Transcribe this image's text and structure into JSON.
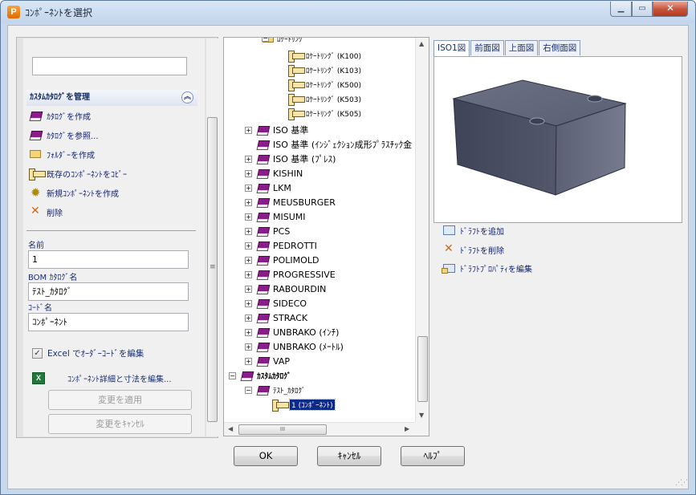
{
  "window": {
    "title": "ｺﾝﾎﾟｰﾈﾝﾄを選択",
    "app_icon_letter": "P"
  },
  "left_panel": {
    "search_value": "",
    "group_title": "ｶｽﾀﾑｶﾀﾛｸﾞを管理",
    "tasks": [
      {
        "label": "ｶﾀﾛｸﾞを作成",
        "icon": "book-create-icon"
      },
      {
        "label": "ｶﾀﾛｸﾞを参照...",
        "icon": "book-browse-icon"
      },
      {
        "label": "ﾌｫﾙﾀﾞｰを作成",
        "icon": "folder-icon"
      },
      {
        "label": "既存のｺﾝﾎﾟｰﾈﾝﾄをｺﾋﾟｰ",
        "icon": "component-copy-icon"
      },
      {
        "label": "新規ｺﾝﾎﾟｰﾈﾝﾄを作成",
        "icon": "gear-new-icon"
      },
      {
        "label": "削除",
        "icon": "delete-icon"
      }
    ],
    "fields": {
      "name_label": "名前",
      "name_value": "1",
      "bom_label": "BOM ｶﾀﾛｸﾞ名",
      "bom_value": "ﾃｽﾄ_ｶﾀﾛｸﾞ",
      "code_label": "ｺｰﾄﾞ名",
      "code_value": "ｺﾝﾎﾟｰﾈﾝﾄ"
    },
    "excel_checkbox_label": "Excel でｵｰﾀﾞｰｺｰﾄﾞを編集",
    "excel_checked": true,
    "edit_details_label": "ｺﾝﾎﾟｰﾈﾝﾄ詳細と寸法を編集...",
    "apply_button": "変更を適用",
    "cancel_changes_button": "変更をｷｬﾝｾﾙ"
  },
  "tree": {
    "partial_top_label": "ﾛｹｰﾄﾘﾝｸﾞ",
    "locate_rings": [
      "ﾛｹｰﾄﾘﾝｸﾞ (K100)",
      "ﾛｹｰﾄﾘﾝｸﾞ (K103)",
      "ﾛｹｰﾄﾘﾝｸﾞ (K500)",
      "ﾛｹｰﾄﾘﾝｸﾞ (K503)",
      "ﾛｹｰﾄﾘﾝｸﾞ (K505)"
    ],
    "catalogs": [
      {
        "label": "ISO 基準",
        "expandable": true
      },
      {
        "label": "ISO 基準 (ｲﾝｼﾞｪｸｼｮﾝ成形ﾌﾟﾗｽﾁｯｸ金",
        "expandable": false
      },
      {
        "label": "ISO 基準 (ﾌﾟﾚｽ)",
        "expandable": true
      },
      {
        "label": "KISHIN",
        "expandable": true
      },
      {
        "label": "LKM",
        "expandable": true
      },
      {
        "label": "MEUSBURGER",
        "expandable": true
      },
      {
        "label": "MISUMI",
        "expandable": true
      },
      {
        "label": "PCS",
        "expandable": true
      },
      {
        "label": "PEDROTTI",
        "expandable": true
      },
      {
        "label": "POLIMOLD",
        "expandable": true
      },
      {
        "label": "PROGRESSIVE",
        "expandable": true
      },
      {
        "label": "RABOURDIN",
        "expandable": true
      },
      {
        "label": "SIDECO",
        "expandable": true
      },
      {
        "label": "STRACK",
        "expandable": true
      },
      {
        "label": "UNBRAKO (ｲﾝﾁ)",
        "expandable": true
      },
      {
        "label": "UNBRAKO (ﾒｰﾄﾙ)",
        "expandable": true
      },
      {
        "label": "VAP",
        "expandable": true
      }
    ],
    "custom_root": "ｶｽﾀﾑｶﾀﾛｸﾞ",
    "custom_catalog": "ﾃｽﾄ_ｶﾀﾛｸﾞ",
    "selected_component": "1 (ｺﾝﾎﾟｰﾈﾝﾄ)",
    "scroll_grip": "III"
  },
  "preview": {
    "tabs": [
      "ISO1図",
      "前面図",
      "上面図",
      "右側面図"
    ],
    "active_tab": 0
  },
  "draft_tasks": [
    {
      "label": "ﾄﾞﾗﾌﾄを追加",
      "icon": "draft-add-icon"
    },
    {
      "label": "ﾄﾞﾗﾌﾄを削除",
      "icon": "delete-icon"
    },
    {
      "label": "ﾄﾞﾗﾌﾄﾌﾟﾛﾊﾟﾃｨを編集",
      "icon": "draft-properties-icon"
    }
  ],
  "buttons": {
    "ok": "OK",
    "cancel": "ｷｬﾝｾﾙ",
    "help": "ﾍﾙﾌﾟ"
  },
  "colors": {
    "catalog_book": "#8b1d8a",
    "selection": "#0b2a8a",
    "title_accent": "#101f6b"
  }
}
